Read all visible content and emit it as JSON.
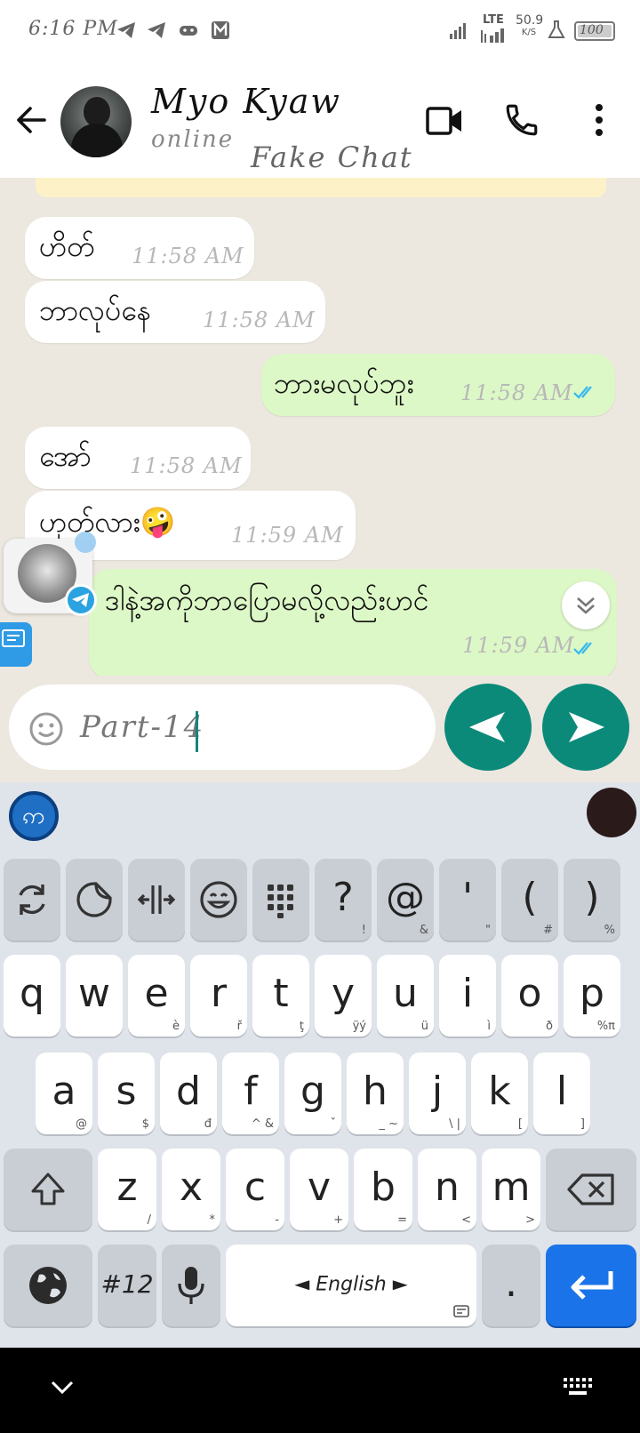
{
  "status_bar": {
    "time": "6:16 PM",
    "network": "LTE",
    "speed_value": "50.9",
    "speed_unit": "K/S",
    "battery": "100"
  },
  "header": {
    "contact_name": "Myo Kyaw",
    "contact_status": "online",
    "watermark": "Fake Chat"
  },
  "messages": [
    {
      "dir": "in",
      "text": "ဟိတ်",
      "time": "11:58 AM"
    },
    {
      "dir": "in",
      "text": "ဘာလုပ်နေ",
      "time": "11:58 AM"
    },
    {
      "dir": "out",
      "text": "ဘားမလုပ်ဘူး",
      "time": "11:58 AM"
    },
    {
      "dir": "in",
      "text": "အော်",
      "time": "11:58 AM"
    },
    {
      "dir": "in",
      "text": "ဟုတ်လား🤪",
      "time": "11:59 AM"
    },
    {
      "dir": "out",
      "text": "ဒါနဲ့အကိုဘာပြောမလို့လည်းဟင်",
      "time": "11:59 AM"
    }
  ],
  "composer": {
    "input_value": "Part-14"
  },
  "keyboard": {
    "top_row": [
      {
        "label": "",
        "sub": "",
        "icon": "sync-icon"
      },
      {
        "label": "",
        "sub": "",
        "icon": "sticker-icon"
      },
      {
        "label": "",
        "sub": "",
        "icon": "resize-icon"
      },
      {
        "label": "",
        "sub": "",
        "icon": "emoji-icon"
      },
      {
        "label": "",
        "sub": "",
        "icon": "numpad-icon"
      },
      {
        "label": "?",
        "sub": "!"
      },
      {
        "label": "@",
        "sub": "&"
      },
      {
        "label": "'",
        "sub": "\""
      },
      {
        "label": "(",
        "sub": "#"
      },
      {
        "label": ")",
        "sub": "%"
      }
    ],
    "row1": [
      {
        "label": "q",
        "sub": ""
      },
      {
        "label": "w",
        "sub": ""
      },
      {
        "label": "e",
        "sub": "è"
      },
      {
        "label": "r",
        "sub": "ř"
      },
      {
        "label": "t",
        "sub": "ţ"
      },
      {
        "label": "y",
        "sub": "ÿý"
      },
      {
        "label": "u",
        "sub": "ü"
      },
      {
        "label": "i",
        "sub": "ì"
      },
      {
        "label": "o",
        "sub": "ð"
      },
      {
        "label": "p",
        "sub": "%π"
      }
    ],
    "row2": [
      {
        "label": "a",
        "sub": "@"
      },
      {
        "label": "s",
        "sub": "$"
      },
      {
        "label": "d",
        "sub": "đ"
      },
      {
        "label": "f",
        "sub": "^ &"
      },
      {
        "label": "g",
        "sub": "ˇ"
      },
      {
        "label": "h",
        "sub": "_ ~"
      },
      {
        "label": "j",
        "sub": "\\ |"
      },
      {
        "label": "k",
        "sub": "["
      },
      {
        "label": "l",
        "sub": "]"
      }
    ],
    "row3": [
      {
        "label": "z",
        "sub": "/"
      },
      {
        "label": "x",
        "sub": "*"
      },
      {
        "label": "c",
        "sub": "-"
      },
      {
        "label": "v",
        "sub": "+"
      },
      {
        "label": "b",
        "sub": "="
      },
      {
        "label": "n",
        "sub": "<"
      },
      {
        "label": "m",
        "sub": ">"
      }
    ],
    "symbols_label": "#12",
    "space_label": "◄ English ►",
    "period_label": "."
  },
  "colors": {
    "accent_green": "#0b8a7a",
    "outgoing_bubble": "#dcf8c6",
    "chat_background": "#ece7df",
    "read_ticks": "#34b7f1",
    "enter_key": "#1a73e8"
  }
}
